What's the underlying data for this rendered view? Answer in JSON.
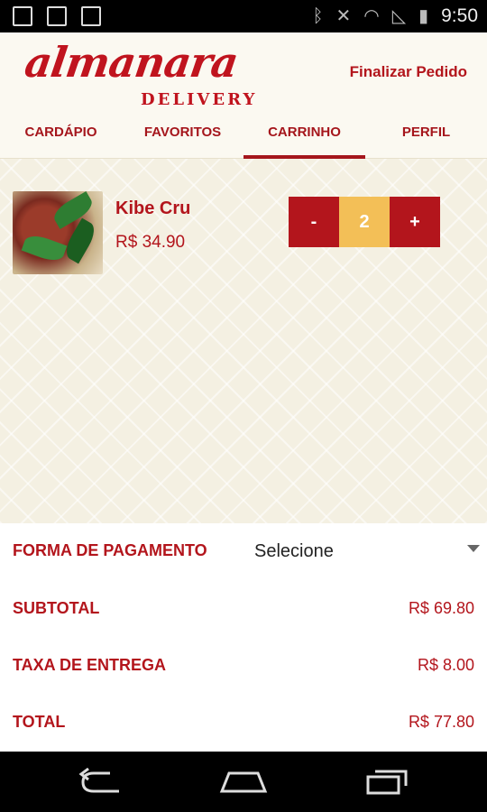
{
  "status_bar": {
    "time": "9:50"
  },
  "header": {
    "logo_main": "almanara",
    "logo_sub": "DELIVERY",
    "finalize_label": "Finalizar Pedido"
  },
  "tabs": [
    {
      "label": "CARDÁPIO",
      "active": false
    },
    {
      "label": "FAVORITOS",
      "active": false
    },
    {
      "label": "CARRINHO",
      "active": true
    },
    {
      "label": "PERFIL",
      "active": false
    }
  ],
  "cart": {
    "items": [
      {
        "name": "Kibe Cru",
        "price": "R$ 34.90",
        "quantity": "2",
        "minus_label": "-",
        "plus_label": "+"
      }
    ]
  },
  "summary": {
    "payment_label": "FORMA DE PAGAMENTO",
    "payment_value": "Selecione",
    "subtotal_label": "SUBTOTAL",
    "subtotal_value": "R$ 69.80",
    "delivery_label": "TAXA DE ENTREGA",
    "delivery_value": "R$ 8.00",
    "total_label": "TOTAL",
    "total_value": "R$ 77.80"
  },
  "colors": {
    "brand_red": "#b3151c",
    "qty_yellow": "#f3bf57",
    "header_bg": "#fbf9f1"
  }
}
